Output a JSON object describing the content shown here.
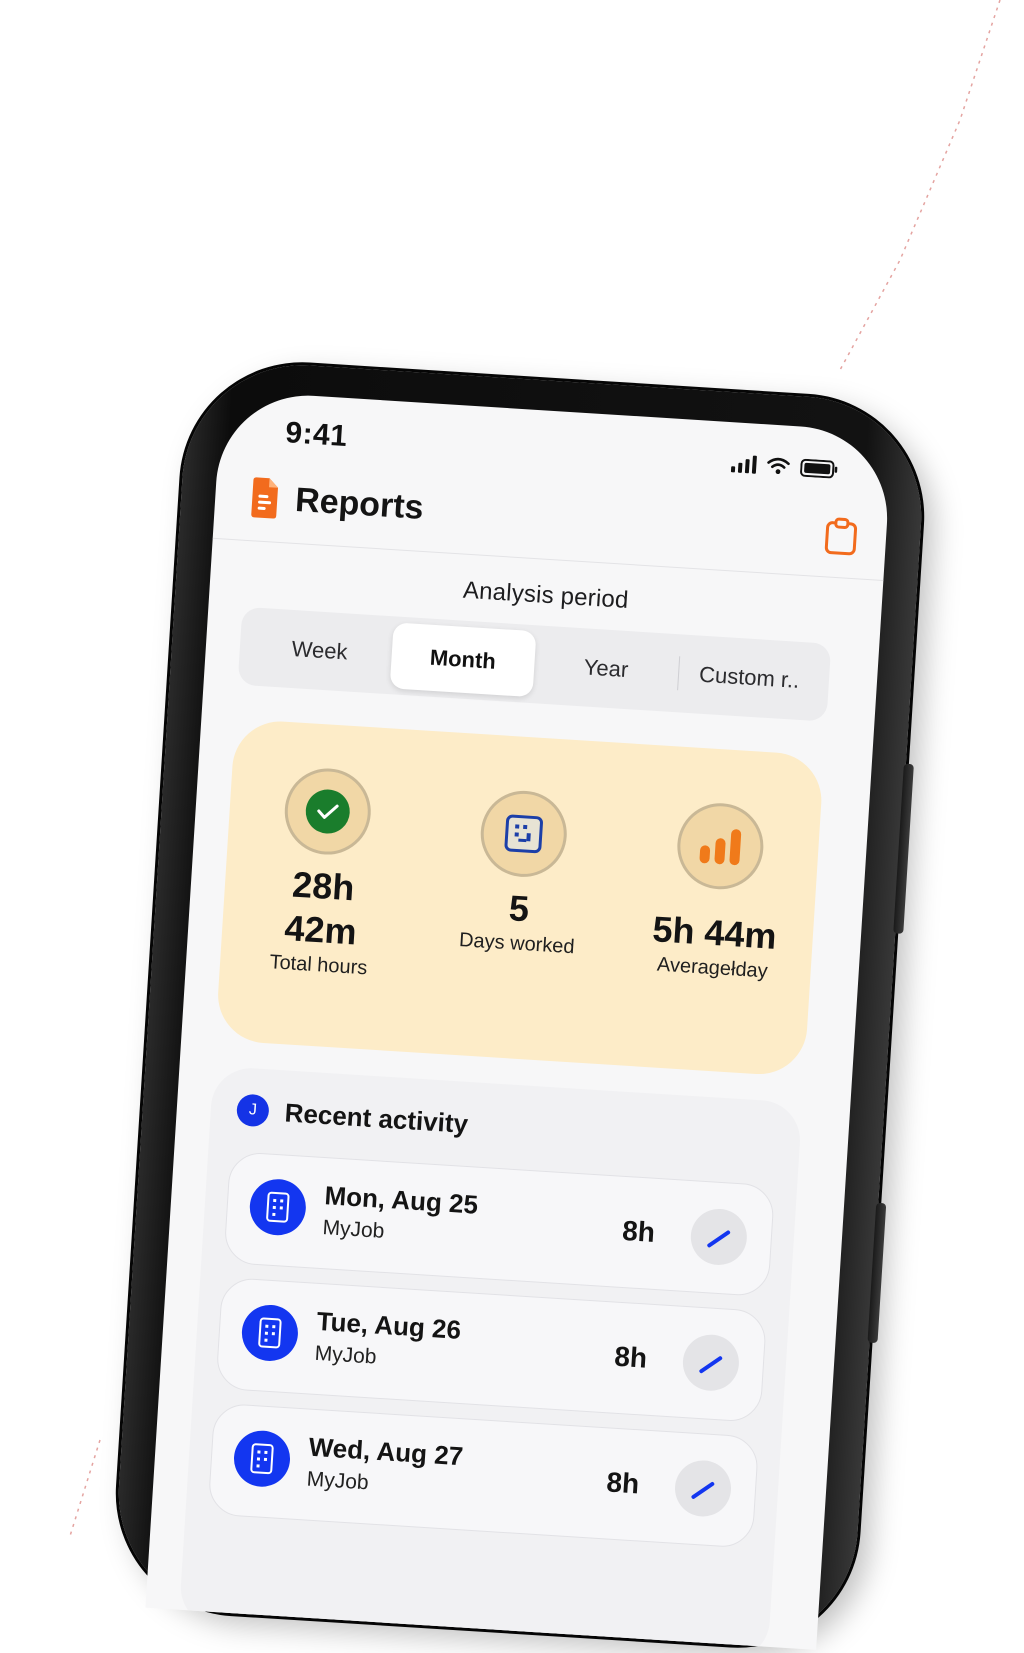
{
  "status_bar": {
    "time": "9:41"
  },
  "header": {
    "title": "Reports",
    "logo_icon": "document-icon",
    "action_icon": "clipboard-icon",
    "accent_color": "#f26b1d"
  },
  "period": {
    "label": "Analysis period",
    "options": [
      "Week",
      "Month",
      "Year",
      "Custom r.."
    ],
    "selected": "Month"
  },
  "stats": {
    "background_color": "#fdecc8",
    "items": [
      {
        "value": "28h 42m",
        "label": "Total hours",
        "icon": "checkmark-icon",
        "icon_color": "#1a7d2c"
      },
      {
        "value": "5",
        "label": "Days worked",
        "icon": "calendar-icon",
        "icon_color": "#1c3fa8"
      },
      {
        "value": "5h 44m",
        "label": "Averagełday",
        "icon": "bar-chart-icon",
        "icon_color": "#f07a1a"
      }
    ]
  },
  "activity": {
    "title": "Recent activity",
    "avatar_letter": "J",
    "accent_color": "#1336f0",
    "items": [
      {
        "date": "Mon, Aug 25",
        "job": "MyJob",
        "hours": "8h"
      },
      {
        "date": "Tue, Aug 26",
        "job": "MyJob",
        "hours": "8h"
      },
      {
        "date": "Wed, Aug 27",
        "job": "MyJob",
        "hours": "8h"
      }
    ]
  }
}
